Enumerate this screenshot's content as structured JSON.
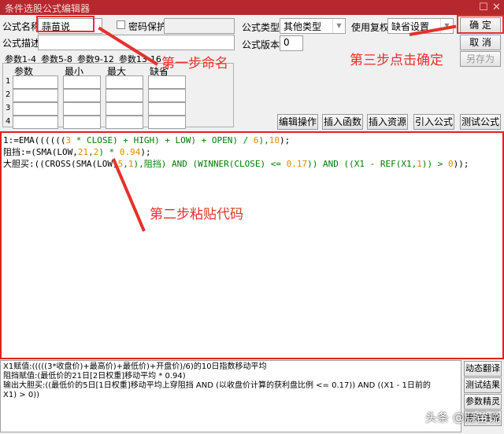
{
  "window": {
    "title": "条件选股公式编辑器"
  },
  "form": {
    "name_label": "公式名称",
    "name_value": "蒜苗说",
    "password_label": "密码保护",
    "desc_label": "公式描述",
    "desc_value": "",
    "type_label": "公式类型",
    "type_value": "其他类型",
    "rights_label": "使用复权",
    "rights_value": "缺省设置",
    "version_label": "公式版本",
    "version_value": "0"
  },
  "buttons": {
    "ok": "确  定",
    "cancel": "取  消",
    "save_as": "另存为",
    "edit_ops": "编辑操作",
    "insert_func": "插入函数",
    "insert_res": "插入资源",
    "import": "引入公式",
    "test": "测试公式"
  },
  "param_tabs": [
    "参数1-4",
    "参数5-8",
    "参数9-12",
    "参数13-16"
  ],
  "param_headers": [
    "参数",
    "最小",
    "最大",
    "缺省"
  ],
  "param_rows": [
    "1",
    "2",
    "3",
    "4"
  ],
  "code": [
    [
      [
        "1:=EMA((((((",
        "k"
      ],
      [
        "3",
        "o"
      ],
      [
        " * CLOSE) + HIGH) + LOW) + OPEN) / ",
        "g"
      ],
      [
        "6",
        "o"
      ],
      [
        "),",
        "g"
      ],
      [
        "10",
        "o"
      ],
      [
        ");",
        "k"
      ]
    ],
    [
      [
        "阻挡:=(SMA(LOW,",
        "k"
      ],
      [
        "21",
        "o"
      ],
      [
        ",",
        "g"
      ],
      [
        "2",
        "o"
      ],
      [
        ") * ",
        "g"
      ],
      [
        "0.94",
        "o"
      ],
      [
        ");",
        "k"
      ]
    ],
    [
      [
        "大胆买:((CROSS(SMA(LOW,",
        "k"
      ],
      [
        "5",
        "o"
      ],
      [
        ",",
        "g"
      ],
      [
        "1",
        "o"
      ],
      [
        "),阻挡) AND (WINNER(CLOSE) <= ",
        "g"
      ],
      [
        "0.17",
        "o"
      ],
      [
        ")) AND ((X1 - REF(X1,",
        "g"
      ],
      [
        "1",
        "o"
      ],
      [
        ")) > ",
        "g"
      ],
      [
        "0",
        "o"
      ],
      [
        "));",
        "k"
      ]
    ]
  ],
  "translation": [
    "X1赋值:(((((3*收盘价)+最高价)+最低价)+开盘价)/6)的10日指数移动平均",
    "阻挡赋值:(最低价的21日[2日权重]移动平均 * 0.94)",
    "输出大胆买:((最低价的5日[1日权重]移动平均上穿阻挡 AND (以收盘价计算的获利盘比例 <= 0.17)) AND ((X1 - 1日前的",
    "X1) > 0))"
  ],
  "side_buttons": [
    "动态翻译",
    "测试结果",
    "参数精灵",
    "用法注释"
  ],
  "annotations": {
    "step1": "第一步命名",
    "step2": "第二步粘贴代码",
    "step3": "第三步点击确定"
  },
  "watermark": "头条 @蒜苗说",
  "colors": {
    "titlebar": "#b7282e",
    "annotation": "#e4322b",
    "keyword": "#007a00",
    "number": "#e08a00"
  }
}
